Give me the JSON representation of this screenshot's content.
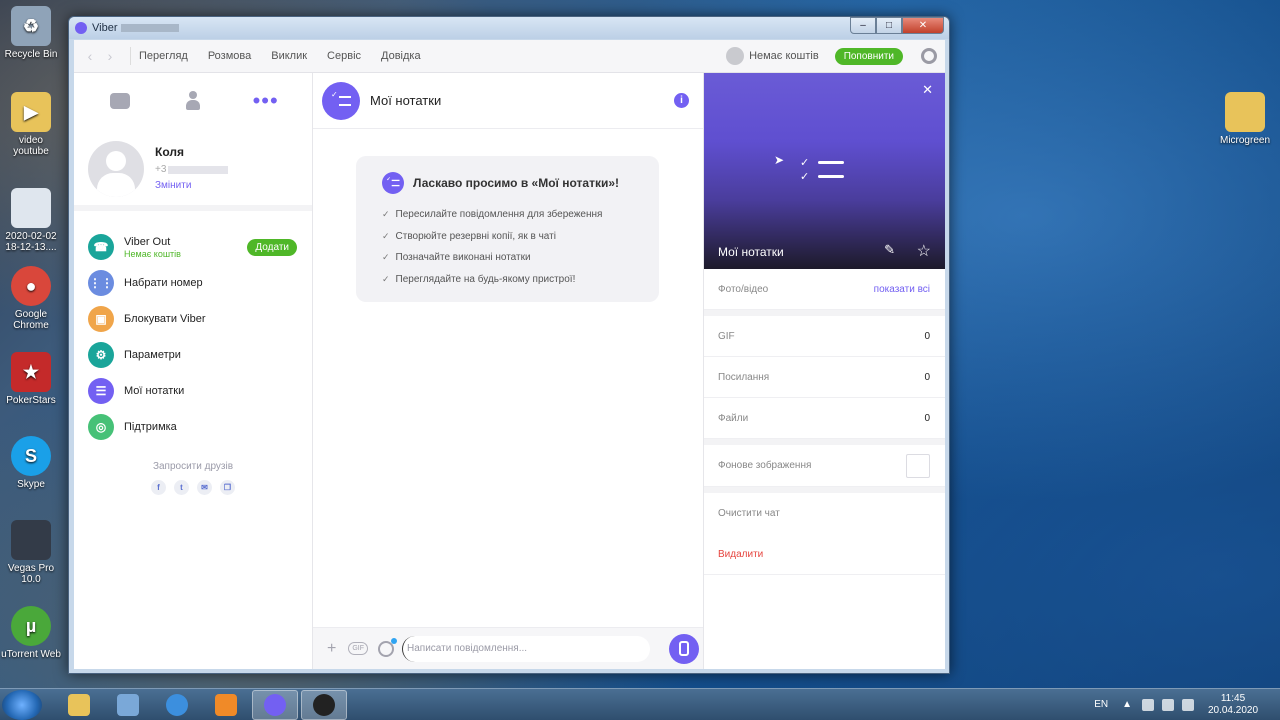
{
  "desktop": {
    "icons": [
      {
        "label": "Recycle Bin",
        "icon": "recycle-bin-icon",
        "color": "#8fa3b8"
      },
      {
        "label": "video youtube",
        "icon": "folder-icon",
        "color": "#e8c35a"
      },
      {
        "label": "2020-02-02 18-12-13....",
        "icon": "image-file-icon",
        "color": "#dfe6ee"
      },
      {
        "label": "Google Chrome",
        "icon": "chrome-icon",
        "color": "#d9473b"
      },
      {
        "label": "PokerStars",
        "icon": "pokerstars-icon",
        "color": "#c42a2a"
      },
      {
        "label": "Skype",
        "icon": "skype-icon",
        "color": "#1aa0e8"
      },
      {
        "label": "Vegas Pro 10.0",
        "icon": "vegas-icon",
        "color": "#333b48"
      },
      {
        "label": "uTorrent Web",
        "icon": "utorrent-icon",
        "color": "#4aa83a"
      },
      {
        "label": "Microgreen",
        "icon": "folder-icon",
        "color": "#e8c35a"
      }
    ]
  },
  "taskbar": {
    "apps": [
      {
        "name": "explorer",
        "color": "#e8c35a"
      },
      {
        "name": "control-panel",
        "color": "#7aa8d8"
      },
      {
        "name": "internet-explorer",
        "color": "#3c8fde"
      },
      {
        "name": "media-player",
        "color": "#f08a28"
      },
      {
        "name": "viber",
        "color": "#7360f2",
        "active": true
      },
      {
        "name": "obs",
        "color": "#222"
      }
    ],
    "language": "EN",
    "time": "11:45",
    "date": "20.04.2020"
  },
  "window": {
    "title": "Viber",
    "minimize": "‒",
    "maximize": "□",
    "close": "✕"
  },
  "toolbar": {
    "menu": [
      "Перегляд",
      "Розмова",
      "Виклик",
      "Сервіс",
      "Довідка"
    ],
    "balance_label": "Немає коштів",
    "topup_label": "Поповнити"
  },
  "profile": {
    "name": "Коля",
    "phone_prefix": "+3",
    "change_label": "Змінити"
  },
  "left_menu": {
    "items": [
      {
        "label": "Viber Out",
        "sub": "Немає коштів",
        "icon": "phone-icon",
        "color": "#1aa59a",
        "action": "Додати"
      },
      {
        "label": "Набрати номер",
        "icon": "dialpad-icon",
        "color": "#6b8ce0"
      },
      {
        "label": "Блокувати Viber",
        "icon": "lock-icon",
        "color": "#f0a54a"
      },
      {
        "label": "Параметри",
        "icon": "settings-icon",
        "color": "#1aa59a"
      },
      {
        "label": "Мої нотатки",
        "icon": "notes-icon",
        "color": "#7360f2"
      },
      {
        "label": "Підтримка",
        "icon": "support-icon",
        "color": "#46c177"
      }
    ],
    "invite_label": "Запросити друзів",
    "socials": [
      "f",
      "t",
      "✉",
      "❐"
    ]
  },
  "chat": {
    "title": "Мої нотатки",
    "welcome_title": "Ласкаво просимо в «Мої нотатки»!",
    "welcome_items": [
      "Пересилайте повідомлення для збереження",
      "Створюйте резервні копії, як в чаті",
      "Позначайте виконані нотатки",
      "Переглядайте на будь-якому пристрої!"
    ],
    "composer_placeholder": "Написати повідомлення..."
  },
  "info_panel": {
    "banner_title": "Мої нотатки",
    "media_label": "Фото/відео",
    "show_all": "показати всі",
    "rows": [
      {
        "label": "GIF",
        "value": "0"
      },
      {
        "label": "Посилання",
        "value": "0"
      },
      {
        "label": "Файли",
        "value": "0"
      }
    ],
    "background_label": "Фонове зображення",
    "clear_label": "Очистити чат",
    "delete_label": "Видалити"
  }
}
